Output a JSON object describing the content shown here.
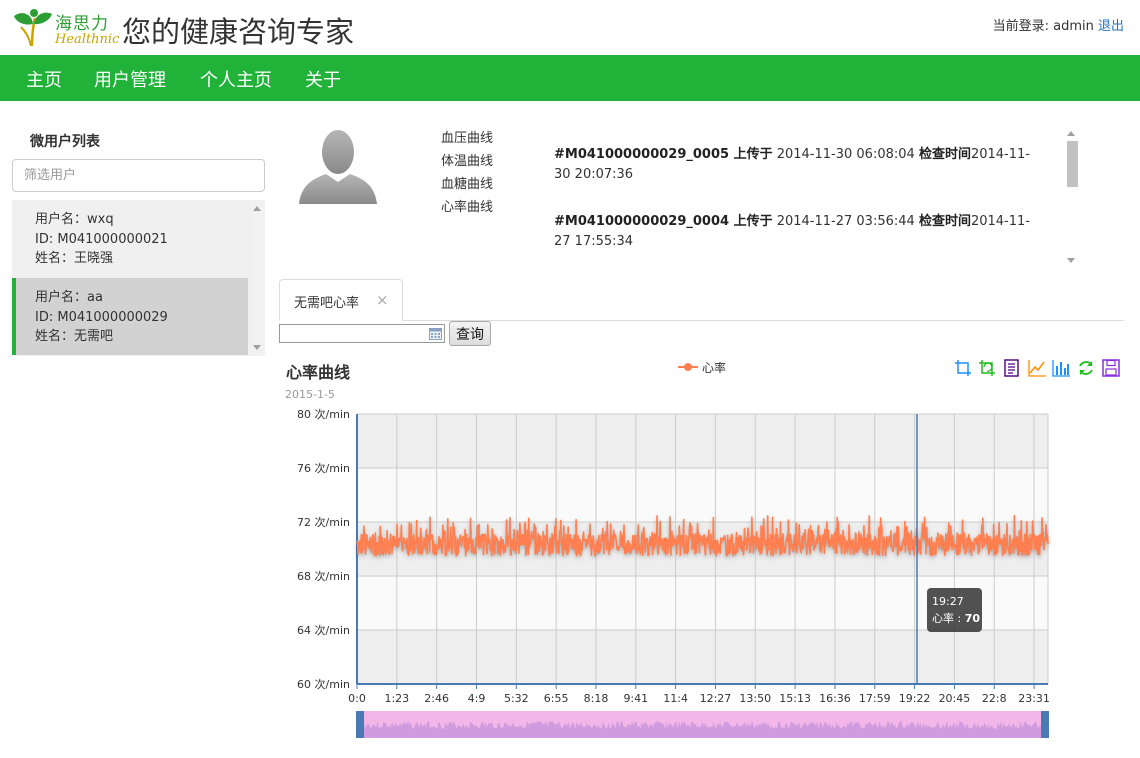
{
  "header": {
    "brand_cn": "海思力",
    "brand_en": "Healthnic",
    "tagline": "您的健康咨询专家",
    "login_prefix": "当前登录: admin",
    "logout_label": "退出"
  },
  "nav": {
    "items": [
      {
        "label": "主页"
      },
      {
        "label": "用户管理"
      },
      {
        "label": "个人主页"
      },
      {
        "label": "关于"
      }
    ]
  },
  "sidebar": {
    "title": "微用户列表",
    "filter_placeholder": "筛选用户",
    "users": [
      {
        "username": "用户名：wxq",
        "id": "ID: M041000000021",
        "name": "姓名：王晓强",
        "active": false
      },
      {
        "username": "用户名：aa",
        "id": "ID: M041000000029",
        "name": "姓名：无需吧",
        "active": true
      }
    ]
  },
  "profile": {
    "curve_links": [
      "血压曲线",
      "体温曲线",
      "血糖曲线",
      "心率曲线"
    ]
  },
  "records": [
    {
      "code": "#M041000000029_0005 上传于",
      "uploaded": " 2014-11-30 06:08:04 ",
      "check_label": "检查时间",
      "checked": "2014-11-30 20:07:36"
    },
    {
      "code": "#M041000000029_0004 上传于",
      "uploaded": " 2014-11-27 03:56:44 ",
      "check_label": "检查时间",
      "checked": "2014-11-27 17:55:34"
    }
  ],
  "tab": {
    "label": "无需吧心率",
    "close": "×"
  },
  "query": {
    "date_value": "",
    "button_label": "查询"
  },
  "toolbox_icons": [
    "data-zoom-icon",
    "data-zoom-reset-icon",
    "data-view-icon",
    "line-chart-icon",
    "bar-chart-icon",
    "restore-icon",
    "save-image-icon"
  ],
  "tooltip": {
    "time": "19:27",
    "label": "心率 : ",
    "value": "70"
  },
  "colors": {
    "brand_green": "#21b23a",
    "series": "#ff7f50",
    "axis": "#4a7ab3",
    "zoom_fill": "#f2b6e8"
  },
  "chart_data": {
    "type": "line",
    "title": "心率曲线",
    "subtitle": "2015-1-5",
    "legend": [
      "心率"
    ],
    "xlabel": "",
    "ylabel": "",
    "ylim": [
      60,
      80
    ],
    "ytick_values": [
      60,
      64,
      68,
      72,
      76,
      80
    ],
    "y_unit": " 次/min",
    "x_tick_labels": [
      "0:0",
      "1:23",
      "2:46",
      "4:9",
      "5:32",
      "6:55",
      "8:18",
      "9:41",
      "11:4",
      "12:27",
      "13:50",
      "15:13",
      "16:36",
      "17:59",
      "19:22",
      "20:45",
      "22:8",
      "23:31"
    ],
    "x_range_minutes": [
      0,
      1440
    ],
    "series": [
      {
        "name": "心率",
        "approx_mean": 70.5,
        "approx_min": 69.5,
        "approx_max": 72
      }
    ],
    "cursor_time": "19:27",
    "cursor_value": 70,
    "grid": true,
    "legend_position": "top-center",
    "data_zoom": true
  }
}
